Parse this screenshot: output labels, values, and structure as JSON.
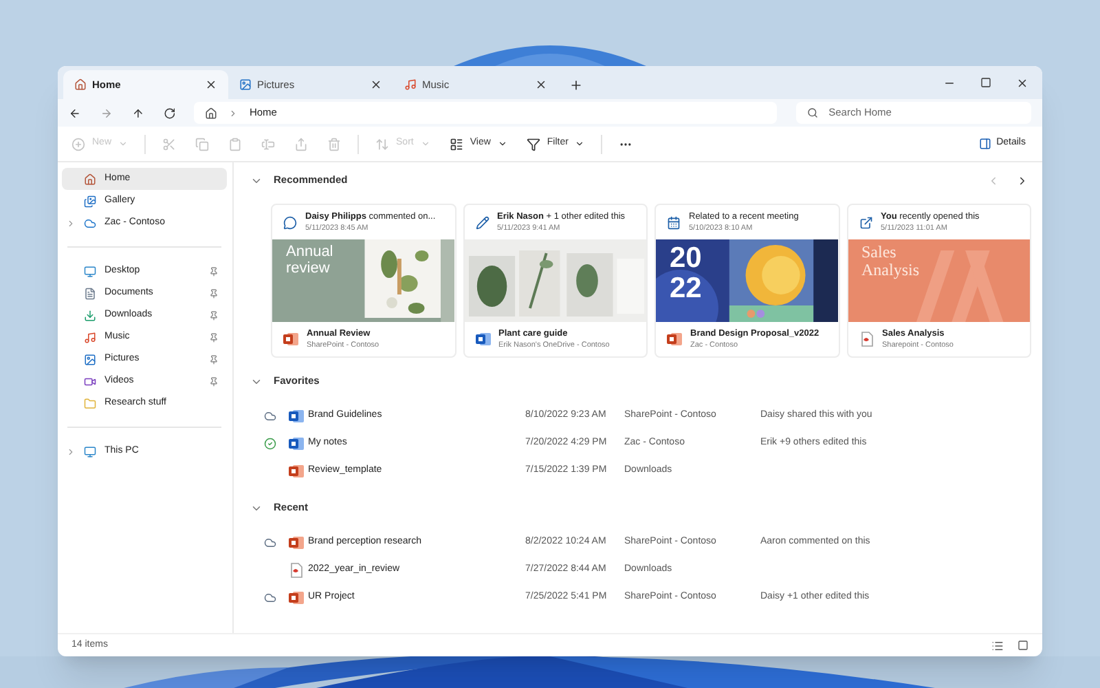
{
  "tabs": [
    {
      "label": "Home",
      "kind": "home",
      "selected": true
    },
    {
      "label": "Pictures",
      "kind": "pictures",
      "selected": false
    },
    {
      "label": "Music",
      "kind": "music",
      "selected": false
    }
  ],
  "address": {
    "path": "Home"
  },
  "search": {
    "placeholder": "Search Home"
  },
  "toolbar": [
    {
      "kind": "new",
      "label": "New",
      "disabled": true
    },
    {
      "kind": "cut",
      "disabled": true
    },
    {
      "kind": "copy",
      "disabled": true
    },
    {
      "kind": "paste",
      "disabled": true
    },
    {
      "kind": "rename",
      "disabled": true
    },
    {
      "kind": "share",
      "disabled": true
    },
    {
      "kind": "delete",
      "disabled": true
    },
    {
      "kind": "sort",
      "label": "Sort",
      "disabled": true
    },
    {
      "kind": "view",
      "label": "View",
      "disabled": false
    },
    {
      "kind": "filter",
      "label": "Filter",
      "disabled": false
    },
    {
      "kind": "more",
      "disabled": false
    }
  ],
  "details_button": "Details",
  "sidebar": {
    "groups": [
      {
        "items": [
          {
            "label": "Home",
            "kind": "home",
            "selected": true
          },
          {
            "label": "Gallery",
            "kind": "gallery",
            "selected": false
          },
          {
            "label": "Zac - Contoso",
            "kind": "cloud",
            "selected": false,
            "expanded": false
          }
        ]
      },
      {
        "items": [
          {
            "label": "Desktop",
            "kind": "desktop",
            "selected": false,
            "pinned": true
          },
          {
            "label": "Documents",
            "kind": "documents",
            "selected": false,
            "pinned": true
          },
          {
            "label": "Downloads",
            "kind": "downloads",
            "selected": false,
            "pinned": true
          },
          {
            "label": "Music",
            "kind": "music",
            "selected": false,
            "pinned": true
          },
          {
            "label": "Pictures",
            "kind": "pictures",
            "selected": false,
            "pinned": true
          },
          {
            "label": "Videos",
            "kind": "videos",
            "selected": false,
            "pinned": true
          },
          {
            "label": "Research stuff",
            "kind": "folder",
            "selected": false,
            "pinned": false
          }
        ]
      },
      {
        "items": [
          {
            "label": "This PC",
            "kind": "pc",
            "selected": false,
            "expanded": false
          }
        ]
      }
    ]
  },
  "recommended": {
    "title": "Recommended",
    "expanded": true,
    "cards": [
      {
        "kind": "comment",
        "headline": "**Daisy Philipps** commented on...",
        "time": "5/11/2023 8:45 AM",
        "thumbnail": {
          "kind": "sage",
          "text": [
            "Annual",
            "review"
          ]
        },
        "file": {
          "kind": "slides",
          "name": "Annual Review",
          "location": "SharePoint - Contoso"
        }
      },
      {
        "kind": "edit",
        "headline": "**Erik Nason** + 1 other edited this",
        "time": "5/11/2023 9:41 AM",
        "thumbnail": {
          "kind": "plants"
        },
        "file": {
          "kind": "doc",
          "name": "Plant care guide",
          "location": "Erik Nason's OneDrive - Contoso"
        }
      },
      {
        "kind": "meeting",
        "headline": "Related to a recent meeting",
        "time": "5/10/2023 8:10 AM",
        "thumbnail": {
          "kind": "blue",
          "text": [
            "20",
            "22"
          ]
        },
        "file": {
          "kind": "slides",
          "name": "Brand Design Proposal_v2022",
          "location": "Zac - Contoso"
        }
      },
      {
        "kind": "opened",
        "headline": "**You** recently opened this",
        "time": "5/11/2023 11:01 AM",
        "thumbnail": {
          "kind": "orange",
          "text": [
            "Sales",
            "Analysis"
          ]
        },
        "file": {
          "kind": "pdf",
          "name": "Sales Analysis",
          "location": "Sharepoint - Contoso"
        }
      }
    ]
  },
  "favorites": {
    "title": "Favorites",
    "expanded": true,
    "rows": [
      {
        "status": {
          "kind": "cloud"
        },
        "kind": "doc",
        "name": "Brand Guidelines",
        "date": "8/10/2022 9:23 AM",
        "location": "SharePoint - Contoso",
        "activity": "Daisy shared this with you"
      },
      {
        "status": {
          "kind": "synced"
        },
        "kind": "doc",
        "name": "My notes",
        "date": "7/20/2022 4:29 PM",
        "location": "Zac - Contoso",
        "activity": "Erik +9 others edited this"
      },
      {
        "kind": "slides",
        "name": "Review_template",
        "date": "7/15/2022 1:39 PM",
        "location": "Downloads"
      }
    ]
  },
  "recent": {
    "title": "Recent",
    "expanded": true,
    "rows": [
      {
        "status": {
          "kind": "cloud"
        },
        "kind": "slides",
        "name": "Brand perception research",
        "date": "8/2/2022 10:24 AM",
        "location": "SharePoint - Contoso",
        "activity": "Aaron commented on this"
      },
      {
        "kind": "pdf",
        "name": "2022_year_in_review",
        "date": "7/27/2022 8:44 AM",
        "location": "Downloads"
      },
      {
        "status": {
          "kind": "cloud"
        },
        "kind": "slides",
        "name": "UR Project",
        "date": "7/25/2022 5:41 PM",
        "location": "SharePoint - Contoso",
        "activity": "Daisy +1 other edited this"
      }
    ]
  },
  "status_bar": {
    "count": "14 items"
  }
}
